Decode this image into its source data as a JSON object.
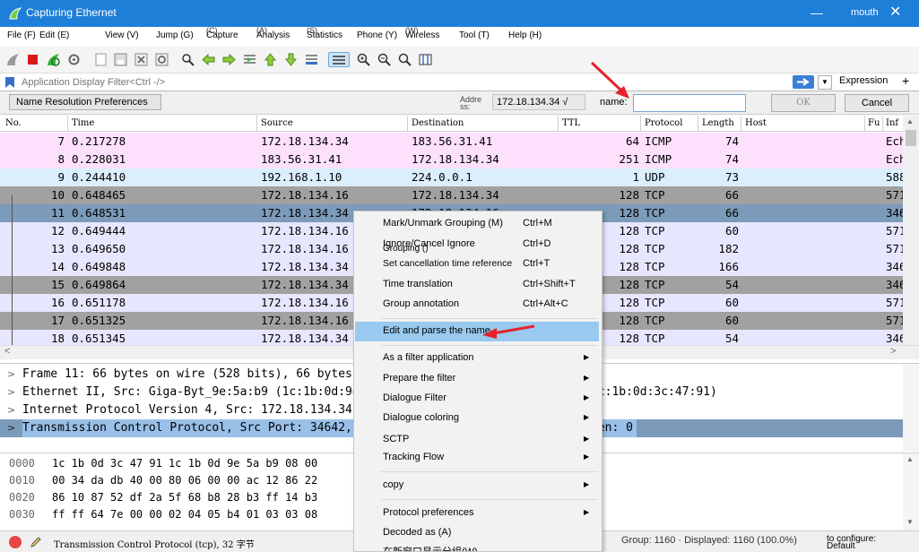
{
  "window": {
    "title": "Capturing Ethernet",
    "user": "mouth",
    "minimize": "—",
    "close": "✕"
  },
  "menu": [
    {
      "label": "File (F)"
    },
    {
      "label": "Edit (E)"
    },
    {
      "label": "View (V)"
    },
    {
      "label": "Jump (G)"
    },
    {
      "label": "Capture",
      "sub": "(C)"
    },
    {
      "label": "Analysis",
      "sub": "(A)"
    },
    {
      "label": "Statistics",
      "sub": "(S)"
    },
    {
      "label": "Phone (Y)"
    },
    {
      "label": "Wireless",
      "sub": "(W)"
    },
    {
      "label": "Tool (T)"
    },
    {
      "label": "Help (H)"
    }
  ],
  "toolbar": {
    "icons": [
      "shark-fin-icon",
      "stop-icon",
      "restart-icon",
      "options-gear-icon",
      "open-file-icon",
      "save-file-icon",
      "close-file-icon",
      "reload-icon",
      "find-icon",
      "back-arrow-icon",
      "forward-arrow-icon",
      "go-to-packet-icon",
      "first-packet-icon",
      "last-packet-icon",
      "autoscroll-icon",
      "colorize-icon",
      "zoom-in-icon",
      "zoom-out-icon",
      "normal-size-icon",
      "resize-columns-icon"
    ]
  },
  "filter": {
    "placeholder": "Application Display Filter<Ctrl -/>",
    "expression": "Expression",
    "plus": "+"
  },
  "namebar": {
    "tab": "Name Resolution Preferences",
    "addr_label": "Addre ss:",
    "addr_value": "172.18.134.34 √",
    "name_label": "name:",
    "name_value": "",
    "ok": "OK",
    "cancel": "Cancel"
  },
  "packets": {
    "columns": [
      "No.",
      "Time",
      "Source",
      "Destination",
      "TTL",
      "Protocol",
      "Length",
      "Host",
      "Fu",
      "Inf"
    ],
    "rows": [
      {
        "no": "7",
        "time": "0.217278",
        "src": "172.18.134.34",
        "dst": "183.56.31.41",
        "ttl": "64",
        "proto": "ICMP",
        "len": "74",
        "info": "Ech",
        "bg": "#fce0fc"
      },
      {
        "no": "8",
        "time": "0.228031",
        "src": "183.56.31.41",
        "dst": "172.18.134.34",
        "ttl": "251",
        "proto": "ICMP",
        "len": "74",
        "info": "Ech",
        "bg": "#fce0fc"
      },
      {
        "no": "9",
        "time": "0.244410",
        "src": "192.168.1.10",
        "dst": "224.0.0.1",
        "ttl": "1",
        "proto": "UDP",
        "len": "73",
        "info": "588",
        "bg": "#dbeefb"
      },
      {
        "no": "10",
        "time": "0.648465",
        "src": "172.18.134.16",
        "dst": "172.18.134.34",
        "ttl": "128",
        "proto": "TCP",
        "len": "66",
        "info": "571",
        "bg": "#a1a1a1"
      },
      {
        "no": "11",
        "time": "0.648531",
        "src": "172.18.134.34",
        "dst": "172.18.134.16",
        "ttl": "128",
        "proto": "TCP",
        "len": "66",
        "info": "346",
        "bg": "#7c9ab9"
      },
      {
        "no": "12",
        "time": "0.649444",
        "src": "172.18.134.16",
        "dst": "172.18.134.34",
        "ttl": "128",
        "proto": "TCP",
        "len": "60",
        "info": "571",
        "bg": "#e7e6ff"
      },
      {
        "no": "13",
        "time": "0.649650",
        "src": "172.18.134.16",
        "dst": "172.18.134.34",
        "ttl": "128",
        "proto": "TCP",
        "len": "182",
        "info": "571",
        "bg": "#e7e6ff"
      },
      {
        "no": "14",
        "time": "0.649848",
        "src": "172.18.134.34",
        "dst": "172.18.134.16",
        "ttl": "128",
        "proto": "TCP",
        "len": "166",
        "info": "346",
        "bg": "#e7e6ff"
      },
      {
        "no": "15",
        "time": "0.649864",
        "src": "172.18.134.34",
        "dst": "172.18.134.16",
        "ttl": "128",
        "proto": "TCP",
        "len": "54",
        "info": "346",
        "bg": "#a1a1a1"
      },
      {
        "no": "16",
        "time": "0.651178",
        "src": "172.18.134.16",
        "dst": "172.18.134.34",
        "ttl": "128",
        "proto": "TCP",
        "len": "60",
        "info": "571",
        "bg": "#e7e6ff"
      },
      {
        "no": "17",
        "time": "0.651325",
        "src": "172.18.134.16",
        "dst": "172.18.134.34",
        "ttl": "128",
        "proto": "TCP",
        "len": "60",
        "info": "571",
        "bg": "#a1a1a1"
      },
      {
        "no": "18",
        "time": "0.651345",
        "src": "172.18.134.34",
        "dst": "172.18.134.16",
        "ttl": "128",
        "proto": "TCP",
        "len": "54",
        "info": "346",
        "bg": "#e7e6ff"
      }
    ]
  },
  "details": [
    {
      "text": "Frame 11: 66 bytes on wire (528 bits), 66 bytes captured (528 bits) on interface 0",
      "selected": false
    },
    {
      "text": "Ethernet II, Src: Giga-Byt_9e:5a:b9 (1c:1b:0d:9e:5a:b9), Dst: Giga-Byt_3c:47:91 (1c:1b:0d:3c:47:91)",
      "selected": false
    },
    {
      "text": "Internet Protocol Version 4, Src: 172.18.134.34, Dst: 172.18.134.16",
      "selected": false
    },
    {
      "text": "Transmission Control Protocol, Src Port: 34642, Dst Port: 57195, Seq: 0, Ack: 1, Len: 0",
      "selected": true
    }
  ],
  "hex": [
    {
      "off": "0000",
      "bytes": "1c 1b 0d 3c 47 91 1c 1b  0d 9e 5a b9 08 00"
    },
    {
      "off": "0010",
      "bytes": "00 34 da db 40 00 80 06  00 00 ac 12 86 22"
    },
    {
      "off": "0020",
      "bytes": "86 10 87 52 df 2a 5f 68  b8 28 b3 ff 14 b3"
    },
    {
      "off": "0030",
      "bytes": "ff ff 64 7e 00 00 02 04  05 b4 01 03 03 08"
    }
  ],
  "status": {
    "left": "Transmission Control Protocol (tcp), 32 字节",
    "group": "Group: 1160 · Displayed: 1160 (100.0%)",
    "profile_label": "to configure:",
    "profile": "Default"
  },
  "context_menu": {
    "items": [
      {
        "label": "Mark/Unmark Grouping (M)",
        "shortcut": "Ctrl+M"
      },
      {
        "label": "Ignore/Cancel Ignore",
        "shortcut": "Ctrl+D"
      },
      {
        "label": "Grouping ()",
        "shortcut": ""
      },
      {
        "label": "Set cancellation time reference",
        "shortcut": "Ctrl+T"
      },
      {
        "label": "Time translation",
        "shortcut": "Ctrl+Shift+T"
      },
      {
        "label": "Group annotation",
        "shortcut": "Ctrl+Alt+C"
      },
      {
        "label": "Edit and parse the name",
        "shortcut": ""
      },
      {
        "label": "As a filter application",
        "arrow": "▶"
      },
      {
        "label": "Prepare the filter",
        "arrow": "▶"
      },
      {
        "label": "Dialogue Filter",
        "arrow": "▶"
      },
      {
        "label": "Dialogue coloring",
        "arrow": "▶"
      },
      {
        "label": "SCTP",
        "arrow": "▶"
      },
      {
        "label": "Tracking Flow",
        "arrow": "▶"
      },
      {
        "label": "copy",
        "arrow": "▶"
      },
      {
        "label": "Protocol preferences",
        "arrow": "▶"
      },
      {
        "label": "Decoded as (A)",
        "arrow": ""
      },
      {
        "label": "在新窗口显示分组(W)",
        "arrow": ""
      }
    ]
  },
  "colors": {
    "titlebar": "#1d7fd7",
    "selected_detail": "#7c9ab9",
    "menu_highlight": "#99c9ef",
    "annotation_arrow": "#e8212a"
  }
}
